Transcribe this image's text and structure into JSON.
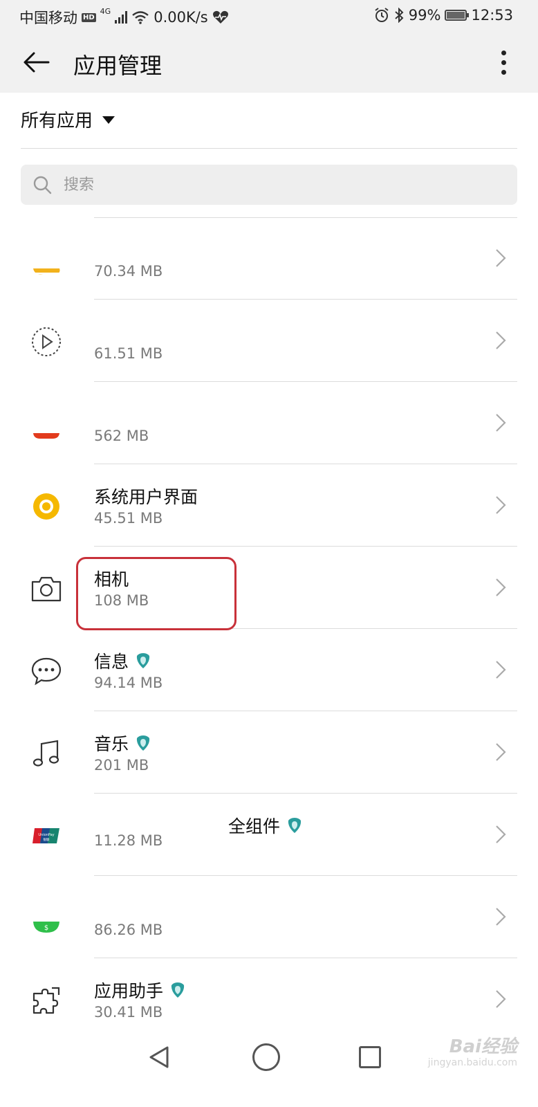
{
  "status_bar": {
    "carrier": "中国移动",
    "hd": "HD",
    "network": "4G",
    "speed": "0.00K/s",
    "battery": "99%",
    "battery_level": 0.99,
    "time": "12:53"
  },
  "header": {
    "title": "应用管理"
  },
  "filter": {
    "label": "所有应用"
  },
  "search": {
    "placeholder": "搜索"
  },
  "apps": [
    {
      "name": "",
      "size": "70.34 MB",
      "icon": "yellow-app-icon",
      "verified": false
    },
    {
      "name": "",
      "size": "61.51 MB",
      "icon": "play-dial-icon",
      "verified": false
    },
    {
      "name": "",
      "size": "562 MB",
      "icon": "red-app-icon",
      "verified": false
    },
    {
      "name": "系统用户界面",
      "size": "45.51 MB",
      "icon": "system-ui-icon",
      "verified": false
    },
    {
      "name": "相机",
      "size": "108 MB",
      "icon": "camera-icon",
      "verified": false
    },
    {
      "name": "信息",
      "size": "94.14 MB",
      "icon": "message-icon",
      "verified": true
    },
    {
      "name": "音乐",
      "size": "201 MB",
      "icon": "music-icon",
      "verified": true
    },
    {
      "name": "全组件",
      "size": "11.28 MB",
      "icon": "unionpay-icon",
      "verified": true
    },
    {
      "name": "",
      "size": "86.26 MB",
      "icon": "green-app-icon",
      "verified": false
    },
    {
      "name": "应用助手",
      "size": "30.41 MB",
      "icon": "puzzle-icon",
      "verified": true
    }
  ],
  "unionpay": {
    "brand": "UnionPay",
    "sub": "银联"
  },
  "watermark": {
    "brand": "Bai经验",
    "sub": "jingyan.baidu.com"
  },
  "colors": {
    "highlight": "#c8313a",
    "verified_badge": "#2a9d9d",
    "system_ui": "#f5b800"
  }
}
